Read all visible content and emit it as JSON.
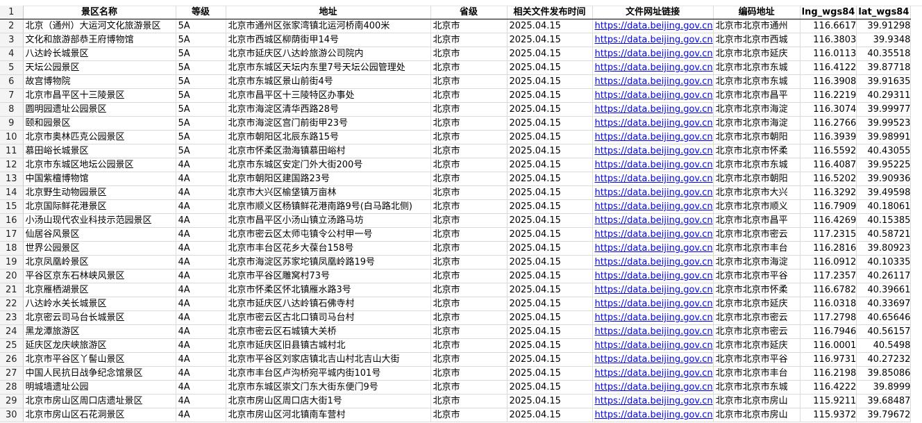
{
  "headers": [
    "景区名称",
    "等级",
    "地址",
    "省级",
    "相关文件发布时间",
    "文件网址链接",
    "编码地址",
    "lng_wgs84",
    "lat_wgs84"
  ],
  "header_row_number": "1",
  "rows": [
    {
      "n": "2",
      "cells": [
        "北京（通州）大运河文化旅游景区",
        "5A",
        "北京市通州区张家湾镇北运河桥南400米",
        "北京市",
        "2025.04.15",
        "https://data.beijing.gov.cn",
        "北京市北京市通州",
        "116.6617",
        "39.91298"
      ]
    },
    {
      "n": "3",
      "cells": [
        "文化和旅游部恭王府博物馆",
        "5A",
        "北京市西城区柳荫街甲14号",
        "北京市",
        "2025.04.15",
        "https://data.beijing.gov.cn",
        "北京市北京市西城",
        "116.3803",
        "39.9348"
      ]
    },
    {
      "n": "4",
      "cells": [
        "八达岭长城景区",
        "5A",
        "北京市延庆区八达岭旅游公司院内",
        "北京市",
        "2025.04.15",
        "https://data.beijing.gov.cn",
        "北京市北京市延庆",
        "116.0113",
        "40.35518"
      ]
    },
    {
      "n": "5",
      "cells": [
        "天坛公园景区",
        "5A",
        "北京市东城区天坛内东里7号天坛公园管理处",
        "北京市",
        "2025.04.15",
        "https://data.beijing.gov.cn",
        "北京市北京市东城",
        "116.4122",
        "39.87718"
      ]
    },
    {
      "n": "6",
      "cells": [
        "故宫博物院",
        "5A",
        "北京市东城区景山前街4号",
        "北京市",
        "2025.04.15",
        "https://data.beijing.gov.cn",
        "北京市北京市东城",
        "116.3908",
        "39.91635"
      ]
    },
    {
      "n": "7",
      "cells": [
        "北京市昌平区十三陵景区",
        "5A",
        "北京市昌平区十三陵特区办事处",
        "北京市",
        "2025.04.15",
        "https://data.beijing.gov.cn",
        "北京市北京市昌平",
        "116.2219",
        "40.29311"
      ]
    },
    {
      "n": "8",
      "cells": [
        "圆明园遗址公园景区",
        "5A",
        "北京市海淀区清华西路28号",
        "北京市",
        "2025.04.15",
        "https://data.beijing.gov.cn",
        "北京市北京市海淀",
        "116.3074",
        "39.99977"
      ]
    },
    {
      "n": "9",
      "cells": [
        "颐和园景区",
        "5A",
        "北京市海淀区宫门前街甲23号",
        "北京市",
        "2025.04.15",
        "https://data.beijing.gov.cn",
        "北京市北京市海淀",
        "116.2766",
        "39.99523"
      ]
    },
    {
      "n": "10",
      "cells": [
        "北京市奥林匹克公园景区",
        "5A",
        "北京市朝阳区北辰东路15号",
        "北京市",
        "2025.04.15",
        "https://data.beijing.gov.cn",
        "北京市北京市朝阳",
        "116.3939",
        "39.98991"
      ]
    },
    {
      "n": "11",
      "cells": [
        "慕田峪长城景区",
        "5A",
        "北京市怀柔区渤海镇慕田峪村",
        "北京市",
        "2025.04.15",
        "https://data.beijing.gov.cn",
        "北京市北京市怀柔",
        "116.5592",
        "40.43055"
      ]
    },
    {
      "n": "12",
      "cells": [
        "北京市东城区地坛公园景区",
        "4A",
        "北京市东城区安定门外大街200号",
        "北京市",
        "2025.04.15",
        "https://data.beijing.gov.cn",
        "北京市北京市东城",
        "116.4087",
        "39.95225"
      ]
    },
    {
      "n": "13",
      "cells": [
        "中国紫檀博物馆",
        "4A",
        "北京市朝阳区建国路23号",
        "北京市",
        "2025.04.15",
        "https://data.beijing.gov.cn",
        "北京市北京市朝阳",
        "116.5202",
        "39.90936"
      ]
    },
    {
      "n": "14",
      "cells": [
        "北京野生动物园景区",
        "4A",
        "北京市大兴区榆垡镇万亩林",
        "北京市",
        "2025.04.15",
        "https://data.beijing.gov.cn",
        "北京市北京市大兴",
        "116.3292",
        "39.49598"
      ]
    },
    {
      "n": "15",
      "cells": [
        "北京国际鲜花港景区",
        "4A",
        "北京市顺义区杨镇鲜花港南路9号(白马路北侧)",
        "北京市",
        "2025.04.15",
        "https://data.beijing.gov.cn",
        "北京市北京市顺义",
        "116.7909",
        "40.18061"
      ]
    },
    {
      "n": "16",
      "cells": [
        "小汤山现代农业科技示范园景区",
        "4A",
        "北京市昌平区小汤山镇立汤路马坊",
        "北京市",
        "2025.04.15",
        "https://data.beijing.gov.cn",
        "北京市北京市昌平",
        "116.4269",
        "40.15385"
      ]
    },
    {
      "n": "17",
      "cells": [
        "仙居谷风景区",
        "4A",
        "北京市密云区太师屯镇令公村甲一号",
        "北京市",
        "2025.04.15",
        "https://data.beijing.gov.cn",
        "北京市北京市密云",
        "117.2315",
        "40.58721"
      ]
    },
    {
      "n": "18",
      "cells": [
        "世界公园景区",
        "4A",
        "北京市丰台区花乡大葆台158号",
        "北京市",
        "2025.04.15",
        "https://data.beijing.gov.cn",
        "北京市北京市丰台",
        "116.2816",
        "39.80923"
      ]
    },
    {
      "n": "19",
      "cells": [
        "北京凤凰岭景区",
        "4A",
        "北京市海淀区苏家坨镇凤凰岭路19号",
        "北京市",
        "2025.04.15",
        "https://data.beijing.gov.cn",
        "北京市北京市海淀",
        "116.0912",
        "40.10335"
      ]
    },
    {
      "n": "20",
      "cells": [
        "平谷区京东石林峡风景区",
        "4A",
        "北京市平谷区雕窝村73号",
        "北京市",
        "2025.04.15",
        "https://data.beijing.gov.cn",
        "北京市北京市平谷",
        "117.2357",
        "40.26117"
      ]
    },
    {
      "n": "21",
      "cells": [
        "北京雁栖湖景区",
        "4A",
        "北京市怀柔区怀北镇雁水路3号",
        "北京市",
        "2025.04.15",
        "https://data.beijing.gov.cn",
        "北京市北京市怀柔",
        "116.6782",
        "40.39661"
      ]
    },
    {
      "n": "22",
      "cells": [
        "八达岭水关长城景区",
        "4A",
        "北京市延庆区八达岭镇石佛寺村",
        "北京市",
        "2025.04.15",
        "https://data.beijing.gov.cn",
        "北京市北京市延庆",
        "116.0318",
        "40.33697"
      ]
    },
    {
      "n": "23",
      "cells": [
        "北京密云司马台长城景区",
        "4A",
        "北京市密云区古北口镇司马台村",
        "北京市",
        "2025.04.15",
        "https://data.beijing.gov.cn",
        "北京市北京市密云",
        "117.2798",
        "40.65646"
      ]
    },
    {
      "n": "24",
      "cells": [
        "黑龙潭旅游区",
        "4A",
        "北京市密云区石城镇大关桥",
        "北京市",
        "2025.04.15",
        "https://data.beijing.gov.cn",
        "北京市北京市密云",
        "116.7946",
        "40.56157"
      ]
    },
    {
      "n": "25",
      "cells": [
        "延庆区龙庆峡旅游区",
        "4A",
        "北京市延庆区旧县镇古城村北",
        "北京市",
        "2025.04.15",
        "https://data.beijing.gov.cn",
        "北京市北京市延庆",
        "116.0001",
        "40.5498"
      ]
    },
    {
      "n": "26",
      "cells": [
        "北京市平谷区丫髻山景区",
        "4A",
        "北京市平谷区刘家店镇北吉山村北吉山大街",
        "北京市",
        "2025.04.15",
        "https://data.beijing.gov.cn",
        "北京市北京市平谷",
        "116.9731",
        "40.27232"
      ]
    },
    {
      "n": "27",
      "cells": [
        "中国人民抗日战争纪念馆景区",
        "4A",
        "北京市丰台区卢沟桥宛平城内街101号",
        "北京市",
        "2025.04.15",
        "https://data.beijing.gov.cn",
        "北京市北京市丰台",
        "116.2198",
        "39.85086"
      ]
    },
    {
      "n": "28",
      "cells": [
        "明城墙遗址公园",
        "4A",
        "北京市东城区崇文门东大街东便门9号",
        "北京市",
        "2025.04.15",
        "https://data.beijing.gov.cn",
        "北京市北京市东城",
        "116.4222",
        "39.8999"
      ]
    },
    {
      "n": "29",
      "cells": [
        "北京市房山区周口店遗址景区",
        "4A",
        "北京市房山区周口店大街1号",
        "北京市",
        "2025.04.15",
        "https://data.beijing.gov.cn",
        "北京市北京市房山",
        "115.9211",
        "39.68487"
      ]
    },
    {
      "n": "30",
      "cells": [
        "北京市房山区石花洞景区",
        "4A",
        "北京市房山区河北镇南车营村",
        "北京市",
        "2025.04.15",
        "https://data.beijing.gov.cn",
        "北京市北京市房山",
        "115.9372",
        "39.79672"
      ]
    }
  ]
}
